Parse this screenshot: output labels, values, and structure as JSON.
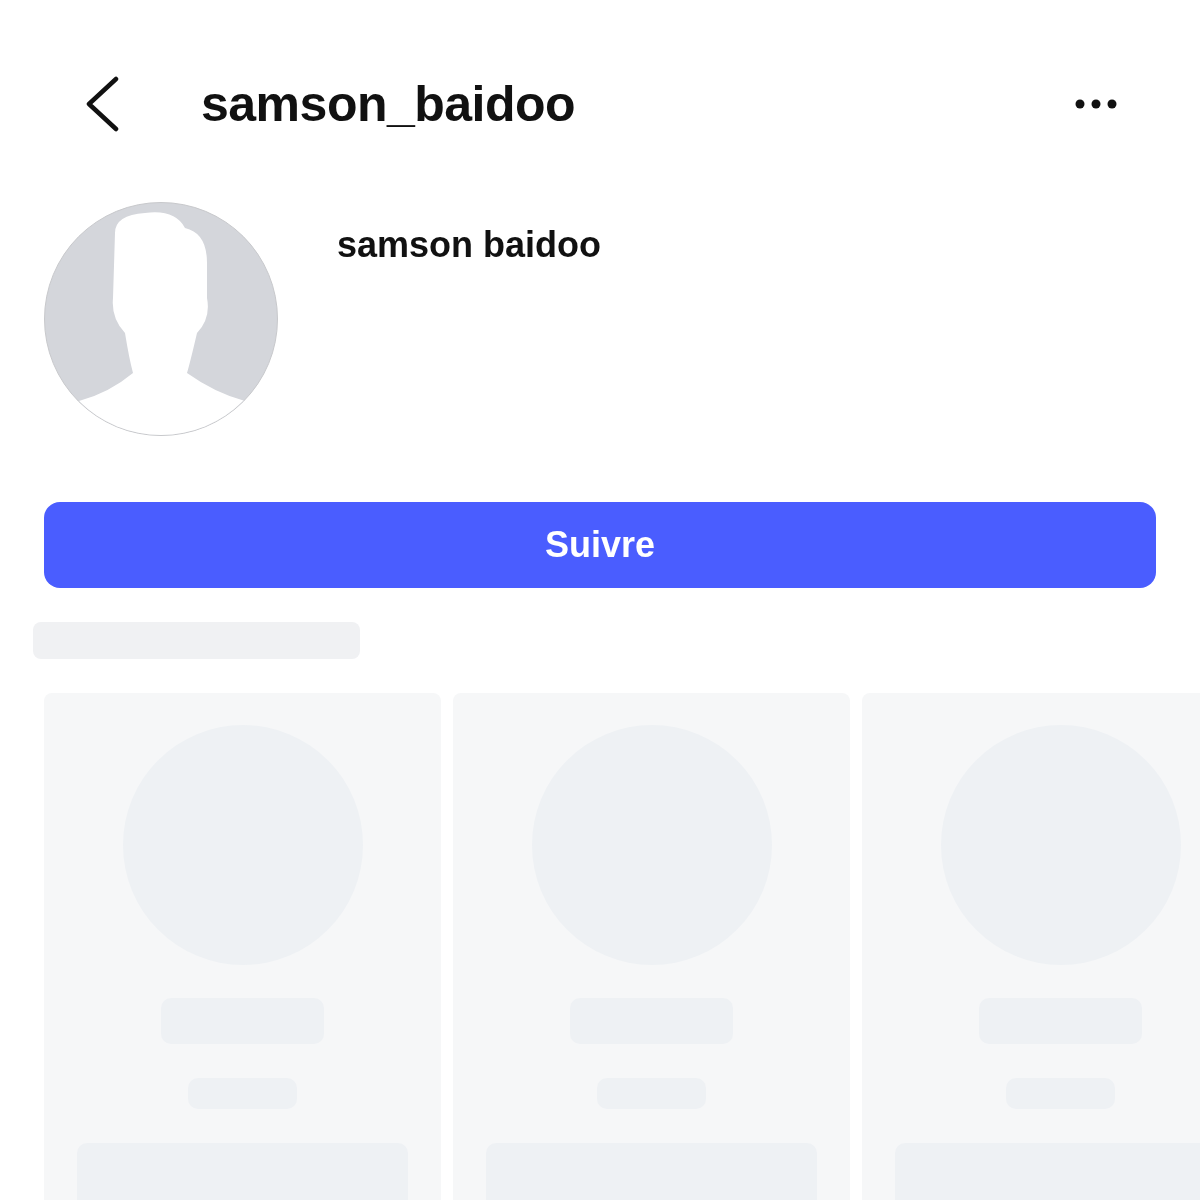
{
  "header": {
    "title": "samson_baidoo"
  },
  "profile": {
    "display_name": "samson baidoo",
    "avatar": {
      "kind": "default-silhouette"
    }
  },
  "follow_button": {
    "label": "Suivre"
  },
  "suggestions": {
    "heading": {
      "kind": "loading"
    },
    "cards": [
      {
        "kind": "loading"
      },
      {
        "kind": "loading"
      },
      {
        "kind": "loading"
      }
    ]
  }
}
